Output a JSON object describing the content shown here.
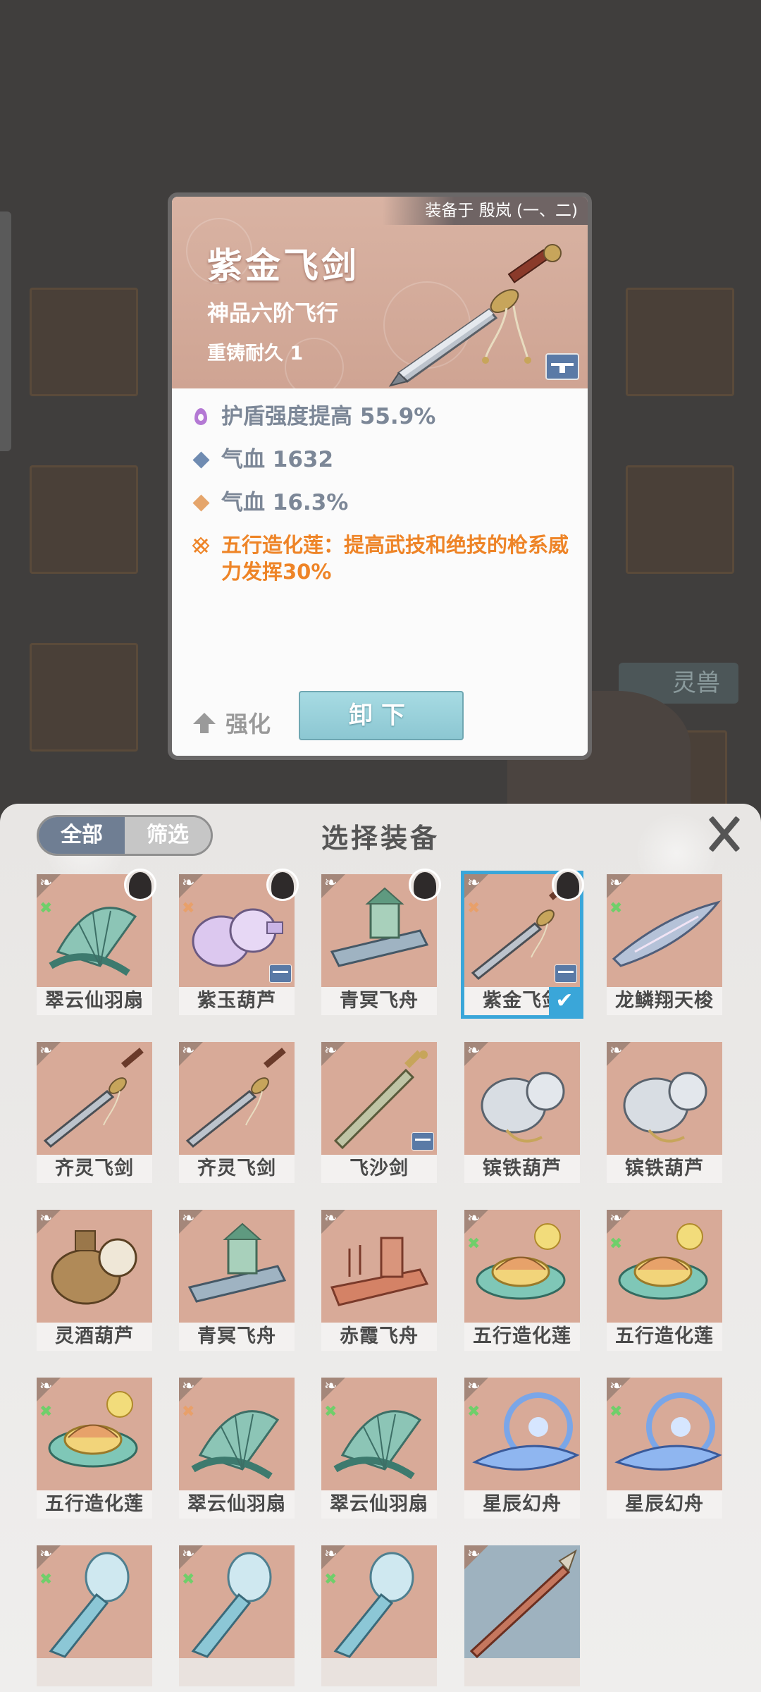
{
  "detail": {
    "equipped_on": "装备于 殷岚 (一、二)",
    "name": "紫金飞剑",
    "grade": "神品六阶飞行",
    "reforge": "重铸耐久 1",
    "stats": [
      {
        "icon": "shield-drop-icon",
        "color": "#b479d4",
        "text": "护盾强度提高 55.9%"
      },
      {
        "icon": "blue-diamond-icon",
        "color": "#6f8bb1",
        "text": "气血 1632"
      },
      {
        "icon": "orange-diamond-icon",
        "color": "#e5a56b",
        "text": "气血 16.3%"
      },
      {
        "icon": "five-elements-icon",
        "color": "#ee8427",
        "text": "五行造化莲：提高武技和绝技的枪系威力发挥30%"
      }
    ],
    "strengthen_label": "强化",
    "unequip_label": "卸下"
  },
  "panel": {
    "tabs": [
      "全部",
      "筛选"
    ],
    "title": "选择装备"
  },
  "background": {
    "pet_label": "灵兽"
  },
  "items": [
    {
      "name": "翠云仙羽扇",
      "element": "green",
      "avatar": true,
      "bag": false,
      "selected": false,
      "art": "fan"
    },
    {
      "name": "紫玉葫芦",
      "element": "orange",
      "avatar": true,
      "bag": true,
      "selected": false,
      "art": "gourd-purple"
    },
    {
      "name": "青冥飞舟",
      "element": "",
      "avatar": true,
      "bag": false,
      "selected": false,
      "art": "boat"
    },
    {
      "name": "紫金飞剑",
      "element": "orange",
      "avatar": true,
      "bag": true,
      "selected": true,
      "art": "sword"
    },
    {
      "name": "龙鳞翔天梭",
      "element": "green",
      "avatar": false,
      "bag": false,
      "selected": false,
      "art": "shuttle"
    },
    {
      "name": "齐灵飞剑",
      "element": "",
      "avatar": false,
      "bag": false,
      "selected": false,
      "art": "sword"
    },
    {
      "name": "齐灵飞剑",
      "element": "",
      "avatar": false,
      "bag": false,
      "selected": false,
      "art": "sword"
    },
    {
      "name": "飞沙剑",
      "element": "",
      "avatar": false,
      "bag": true,
      "selected": false,
      "art": "sword-gold"
    },
    {
      "name": "镔铁葫芦",
      "element": "",
      "avatar": false,
      "bag": false,
      "selected": false,
      "art": "gourd"
    },
    {
      "name": "镔铁葫芦",
      "element": "",
      "avatar": false,
      "bag": false,
      "selected": false,
      "art": "gourd"
    },
    {
      "name": "灵酒葫芦",
      "element": "",
      "avatar": false,
      "bag": false,
      "selected": false,
      "art": "gourd-brown"
    },
    {
      "name": "青冥飞舟",
      "element": "",
      "avatar": false,
      "bag": false,
      "selected": false,
      "art": "boat"
    },
    {
      "name": "赤霞飞舟",
      "element": "",
      "avatar": false,
      "bag": false,
      "selected": false,
      "art": "boat-red"
    },
    {
      "name": "五行造化莲",
      "element": "green",
      "avatar": false,
      "bag": false,
      "selected": false,
      "art": "lotus"
    },
    {
      "name": "五行造化莲",
      "element": "green",
      "avatar": false,
      "bag": false,
      "selected": false,
      "art": "lotus"
    },
    {
      "name": "五行造化莲",
      "element": "green",
      "avatar": false,
      "bag": false,
      "selected": false,
      "art": "lotus"
    },
    {
      "name": "翠云仙羽扇",
      "element": "orange",
      "avatar": false,
      "bag": false,
      "selected": false,
      "art": "fan"
    },
    {
      "name": "翠云仙羽扇",
      "element": "green",
      "avatar": false,
      "bag": false,
      "selected": false,
      "art": "fan"
    },
    {
      "name": "星辰幻舟",
      "element": "green",
      "avatar": false,
      "bag": false,
      "selected": false,
      "art": "star-boat"
    },
    {
      "name": "星辰幻舟",
      "element": "green",
      "avatar": false,
      "bag": false,
      "selected": false,
      "art": "star-boat"
    },
    {
      "name": "",
      "element": "green",
      "avatar": false,
      "bag": false,
      "selected": false,
      "art": "bottle"
    },
    {
      "name": "",
      "element": "green",
      "avatar": false,
      "bag": false,
      "selected": false,
      "art": "bottle"
    },
    {
      "name": "",
      "element": "green",
      "avatar": false,
      "bag": false,
      "selected": false,
      "art": "bottle"
    },
    {
      "name": "",
      "element": "",
      "avatar": false,
      "bag": false,
      "selected": false,
      "art": "spear"
    }
  ]
}
